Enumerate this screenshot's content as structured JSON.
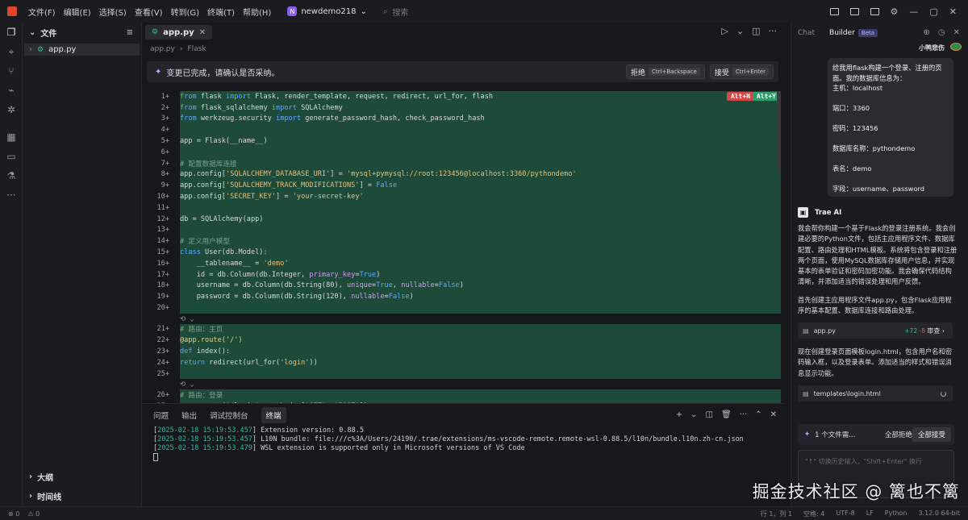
{
  "titlebar": {
    "menus": [
      "文件(F)",
      "编辑(E)",
      "选择(S)",
      "查看(V)",
      "转到(G)",
      "终端(T)",
      "帮助(H)"
    ],
    "project_badge": "N",
    "project": "newdemo218",
    "search_placeholder": "搜索",
    "window_controls": [
      "—",
      "▢",
      "✕"
    ]
  },
  "explorer": {
    "header": "文件",
    "file": "app.py",
    "outline": "大纲",
    "timeline": "时间线"
  },
  "editor": {
    "tab": "app.py",
    "breadcrumb": [
      "app.py",
      "Flask"
    ],
    "notice": "变更已完成，请确认是否采纳。",
    "reject": "拒绝",
    "reject_key": "Ctrl+Backspace",
    "accept": "接受",
    "accept_key": "Ctrl+Enter",
    "hint_reject": "Alt+N",
    "hint_accept": "Alt+Y",
    "lines": [
      {
        "n": "1",
        "t": "from flask import Flask, render_template, request, redirect, url_for, flash"
      },
      {
        "n": "2",
        "t": "from flask_sqlalchemy import SQLAlchemy"
      },
      {
        "n": "3",
        "t": "from werkzeug.security import generate_password_hash, check_password_hash"
      },
      {
        "n": "4",
        "t": ""
      },
      {
        "n": "5",
        "t": "app = Flask(__name__)"
      },
      {
        "n": "6",
        "t": ""
      },
      {
        "n": "7",
        "t": "# 配置数据库连接"
      },
      {
        "n": "8",
        "t": "app.config['SQLALCHEMY_DATABASE_URI'] = 'mysql+pymysql://root:123456@localhost:3360/pythondemo'"
      },
      {
        "n": "9",
        "t": "app.config['SQLALCHEMY_TRACK_MODIFICATIONS'] = False"
      },
      {
        "n": "10",
        "t": "app.config['SECRET_KEY'] = 'your-secret-key'"
      },
      {
        "n": "11",
        "t": ""
      },
      {
        "n": "12",
        "t": "db = SQLAlchemy(app)"
      },
      {
        "n": "13",
        "t": ""
      },
      {
        "n": "14",
        "t": "# 定义用户模型"
      },
      {
        "n": "15",
        "t": "class User(db.Model):"
      },
      {
        "n": "16",
        "t": "    __tablename__ = 'demo'"
      },
      {
        "n": "17",
        "t": "    id = db.Column(db.Integer, primary_key=True)"
      },
      {
        "n": "18",
        "t": "    username = db.Column(db.String(80), unique=True, nullable=False)"
      },
      {
        "n": "19",
        "t": "    password = db.Column(db.String(120), nullable=False)"
      },
      {
        "n": "20",
        "t": ""
      },
      {
        "n": "",
        "t": "⟲ ⌄"
      },
      {
        "n": "21",
        "t": "# 路由：主页"
      },
      {
        "n": "22",
        "t": "@app.route('/')"
      },
      {
        "n": "23",
        "t": "def index():"
      },
      {
        "n": "24",
        "t": "    return redirect(url_for('login'))"
      },
      {
        "n": "25",
        "t": ""
      },
      {
        "n": "",
        "t": "⟲ ⌄"
      },
      {
        "n": "26",
        "t": "# 路由：登录"
      },
      {
        "n": "27",
        "t": "@app.route('/login', methods=['GET', 'POST'])"
      }
    ]
  },
  "panel": {
    "tabs": [
      "问题",
      "输出",
      "调试控制台",
      "终端"
    ],
    "terminal": [
      {
        "ts": "2025-02-18 15:19:53.457",
        "msg": "Extension version: 0.88.5"
      },
      {
        "ts": "2025-02-18 15:19:53.457",
        "msg": "L10N bundle: file:///c%3A/Users/24190/.trae/extensions/ms-vscode-remote.remote-wsl-0.88.5/l10n/bundle.l10n.zh-cn.json"
      },
      {
        "ts": "2025-02-18 15:19:53.479",
        "msg": "WSL extension is supported only in Microsoft versions of VS Code"
      }
    ]
  },
  "assistant": {
    "tab_chat": "Chat",
    "tab_builder": "Builder",
    "beta": "Beta",
    "user_name": "小鸭悲伤",
    "user_message": [
      "给我用flask构建一个登录、注册的页面。我的数据库信息为：",
      "主机：localhost",
      "",
      "端口：3360",
      "",
      "密码：123456",
      "",
      "数据库名称：pythondemo",
      "",
      "表名：demo",
      "",
      "字段：username、password"
    ],
    "ai_name": "Trae AI",
    "ai_text_1": "我会帮你构建一个基于Flask的登录注册系统。我会创建必要的Python文件，包括主应用程序文件、数据库配置、路由处理和HTML模板。系统将包含登录和注册两个页面，使用MySQL数据库存储用户信息，并实现基本的表单验证和密码加密功能。我会确保代码结构清晰，并添加适当的错误处理和用户反馈。",
    "ai_text_2": "首先创建主应用程序文件app.py，包含Flask应用程序的基本配置、数据库连接和路由处理。",
    "file1": "app.py",
    "file1_add": "+72",
    "file1_del": "-8",
    "file1_action": "审查",
    "ai_text_3": "现在创建登录页面模板login.html，包含用户名和密码输入框，以及登录表单。添加适当的样式和错误消息显示功能。",
    "file2": "templates\\login.html",
    "pending": "1 个文件需...",
    "reject_all": "全部拒绝",
    "accept_all": "全部接受",
    "input_placeholder": "\"↑\" 切换历史输入，\"Shift+Enter\" 换行"
  },
  "statusbar": {
    "errors": "0",
    "warnings": "0",
    "position": "行 1，列 1",
    "spaces": "空格: 4",
    "encoding": "UTF-8",
    "eol": "LF",
    "language": "Python",
    "version": "3.12.0 64-bit"
  },
  "watermark": "掘金技术社区 @ 篱也不篱",
  "colors": {
    "added_line": "#1e4a3a",
    "accent_red": "#e0442e",
    "hint_reject": "#d04848",
    "hint_accept": "#2f9a6a"
  }
}
